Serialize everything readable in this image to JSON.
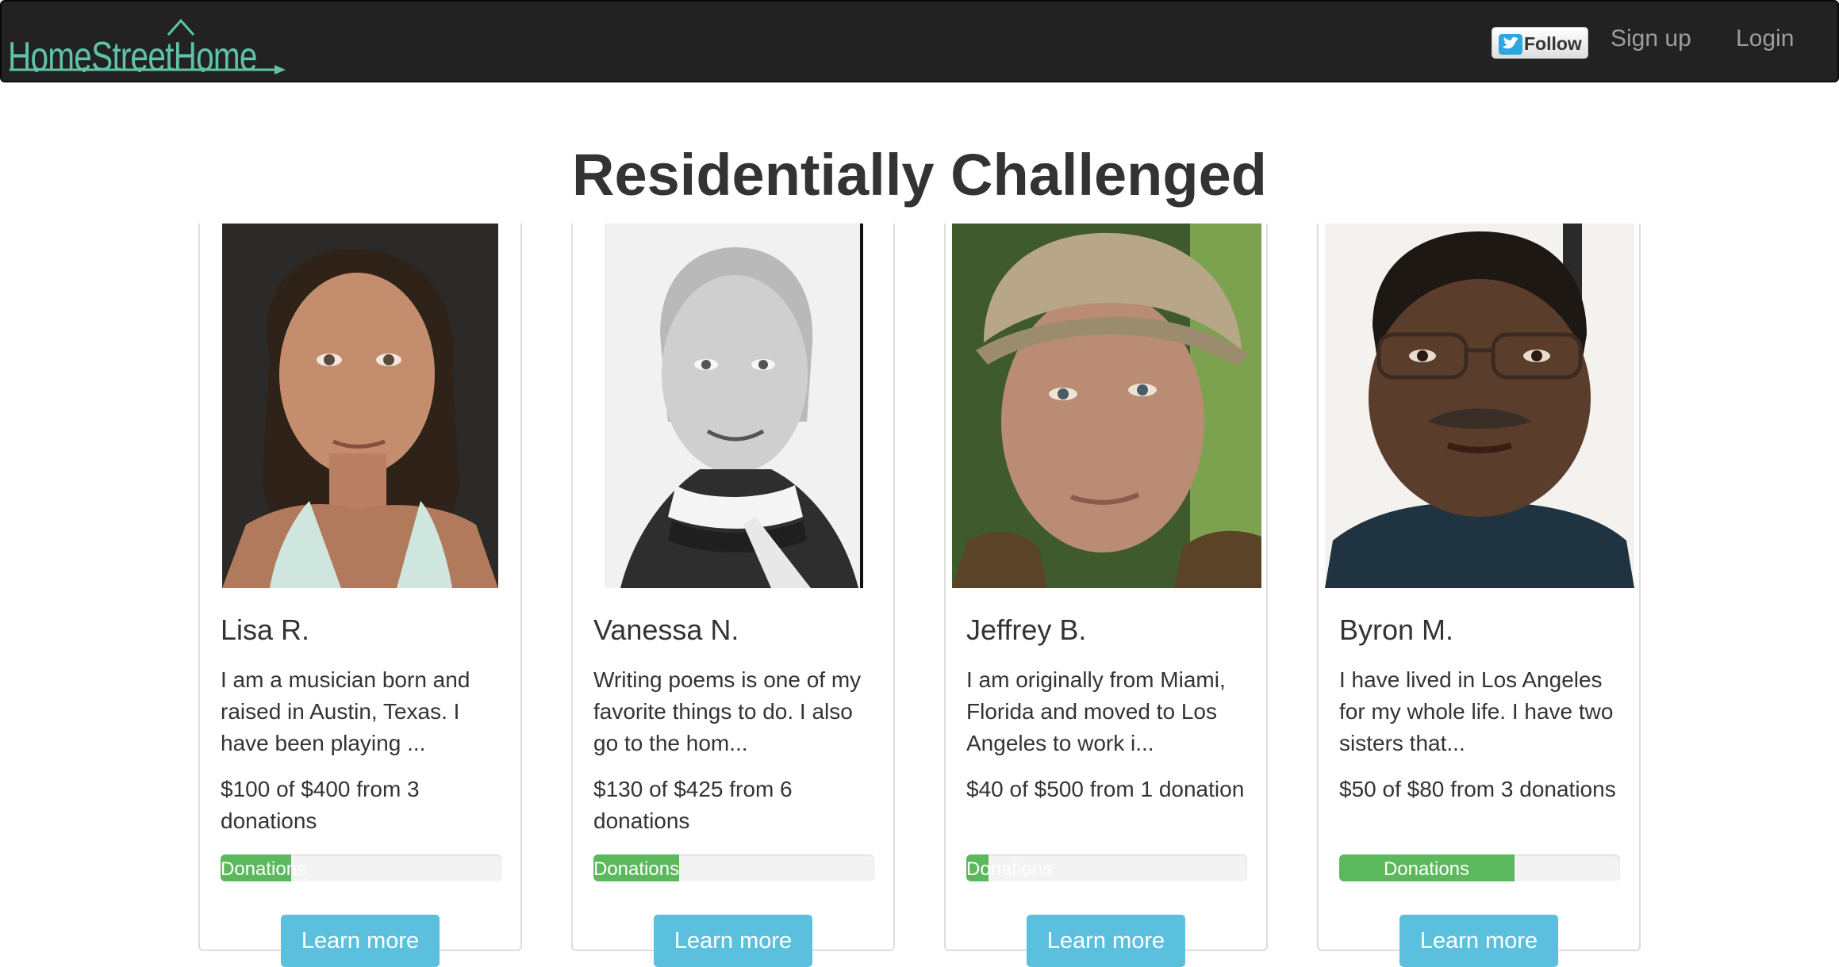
{
  "navbar": {
    "brand": "HomeStreetHome",
    "follow_label": "Follow",
    "signup_label": "Sign up",
    "login_label": "Login"
  },
  "page": {
    "title": "Residentially Challenged"
  },
  "colors": {
    "brand": "#5ec3a8",
    "navbar_bg": "#222222",
    "progress": "#5cb85c",
    "button": "#5bc0de"
  },
  "cards": [
    {
      "name": "Lisa R.",
      "description": "I am a musician born and raised in Austin, Texas. I have been playing ...",
      "amount_text": "$100 of $400 from 3 donations",
      "progress_label": "Donations",
      "progress_fraction": 0.25,
      "button_label": "Learn more"
    },
    {
      "name": "Vanessa N.",
      "description": "Writing poems is one of my favorite things to do. I also go to the hom...",
      "amount_text": "$130 of $425 from 6 donations",
      "progress_label": "Donations",
      "progress_fraction": 0.306,
      "button_label": "Learn more"
    },
    {
      "name": "Jeffrey B.",
      "description": "I am originally from Miami, Florida and moved to Los Angeles to work i...",
      "amount_text": "$40 of $500 from 1 donation",
      "progress_label": "Donations",
      "progress_fraction": 0.08,
      "button_label": "Learn more"
    },
    {
      "name": "Byron M.",
      "description": "I have lived in Los Angeles for my whole life. I have two sisters that...",
      "amount_text": "$50 of $80 from 3 donations",
      "progress_label": "Donations",
      "progress_fraction": 0.625,
      "button_label": "Learn more"
    }
  ]
}
